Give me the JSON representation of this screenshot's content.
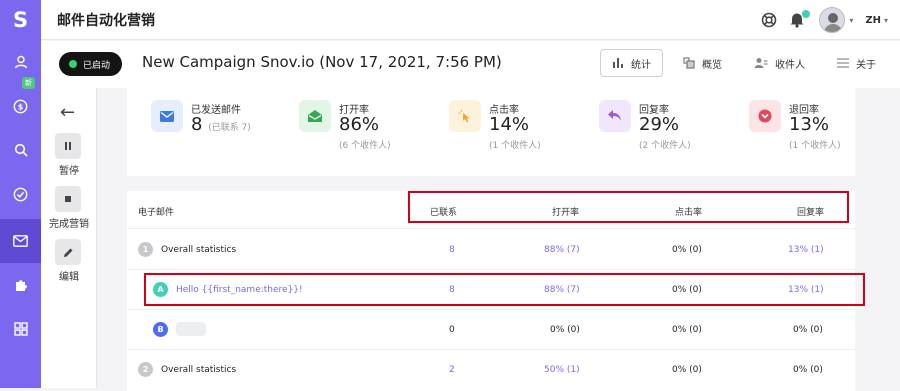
{
  "app": {
    "logo": "S",
    "title": "邮件自动化营销",
    "lang": "ZH"
  },
  "sidebar": {
    "new_badge": "新"
  },
  "campaign": {
    "status": "已启动",
    "name": "New Campaign Snov.io (Nov 17, 2021, 7:56 PM)",
    "tabs": [
      {
        "label": "统计"
      },
      {
        "label": "概览"
      },
      {
        "label": "收件人"
      },
      {
        "label": "关于"
      }
    ]
  },
  "leftpanel": {
    "pause": "暂停",
    "complete": "完成营销",
    "edit": "编辑"
  },
  "stats": [
    {
      "label": "已发送邮件",
      "value": "8",
      "inline": "(已联系 7)",
      "sub": ""
    },
    {
      "label": "打开率",
      "value": "86%",
      "inline": "",
      "sub": "(6 个收件人)"
    },
    {
      "label": "点击率",
      "value": "14%",
      "inline": "",
      "sub": "(1 个收件人)"
    },
    {
      "label": "回复率",
      "value": "29%",
      "inline": "",
      "sub": "(2 个收件人)"
    },
    {
      "label": "退回率",
      "value": "13%",
      "inline": "",
      "sub": "(1 个收件人)"
    }
  ],
  "table": {
    "headers": {
      "email": "电子邮件",
      "contacted": "已联系",
      "open": "打开率",
      "click": "点击率",
      "reply": "回复率"
    },
    "rows": [
      {
        "badge": "1",
        "name": "Overall statistics",
        "contacted": "8",
        "open": "88% (7)",
        "click": "0% (0)",
        "reply": "13% (1)"
      },
      {
        "badge": "A",
        "name": "Hello {{first_name:there}}!",
        "contacted": "8",
        "open": "88% (7)",
        "click": "0% (0)",
        "reply": "13% (1)"
      },
      {
        "badge": "B",
        "name": "",
        "contacted": "0",
        "open": "0% (0)",
        "click": "0% (0)",
        "reply": "0% (0)"
      },
      {
        "badge": "2",
        "name": "Overall statistics",
        "contacted": "2",
        "open": "50% (1)",
        "click": "0% (0)",
        "reply": "0% (0)"
      }
    ]
  },
  "colors": {
    "accent": "#7b68ee",
    "highlight": "#d0021b",
    "status_dot": "#36d36b"
  }
}
